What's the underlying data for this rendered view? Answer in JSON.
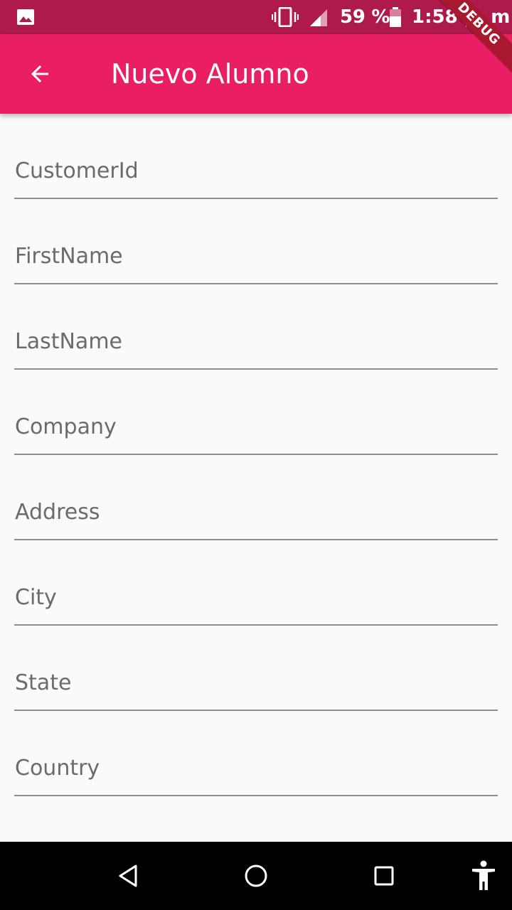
{
  "status_bar": {
    "battery_percent": "59 %",
    "time": "1:58 p. m.",
    "background": "#ad1a4b",
    "battery_level": 0.59
  },
  "app_bar": {
    "title": "Nuevo Alumno",
    "back_icon": "arrow-back-icon",
    "background": "#e91e63"
  },
  "debug_banner": {
    "label": "DEBUG"
  },
  "form": {
    "fields": [
      {
        "label": "CustomerId",
        "value": ""
      },
      {
        "label": "FirstName",
        "value": ""
      },
      {
        "label": "LastName",
        "value": ""
      },
      {
        "label": "Company",
        "value": ""
      },
      {
        "label": "Address",
        "value": ""
      },
      {
        "label": "City",
        "value": ""
      },
      {
        "label": "State",
        "value": ""
      },
      {
        "label": "Country",
        "value": ""
      }
    ]
  },
  "nav_bar": {
    "buttons": [
      "back-triangle-icon",
      "home-circle-icon",
      "recents-square-icon",
      "accessibility-icon"
    ]
  }
}
